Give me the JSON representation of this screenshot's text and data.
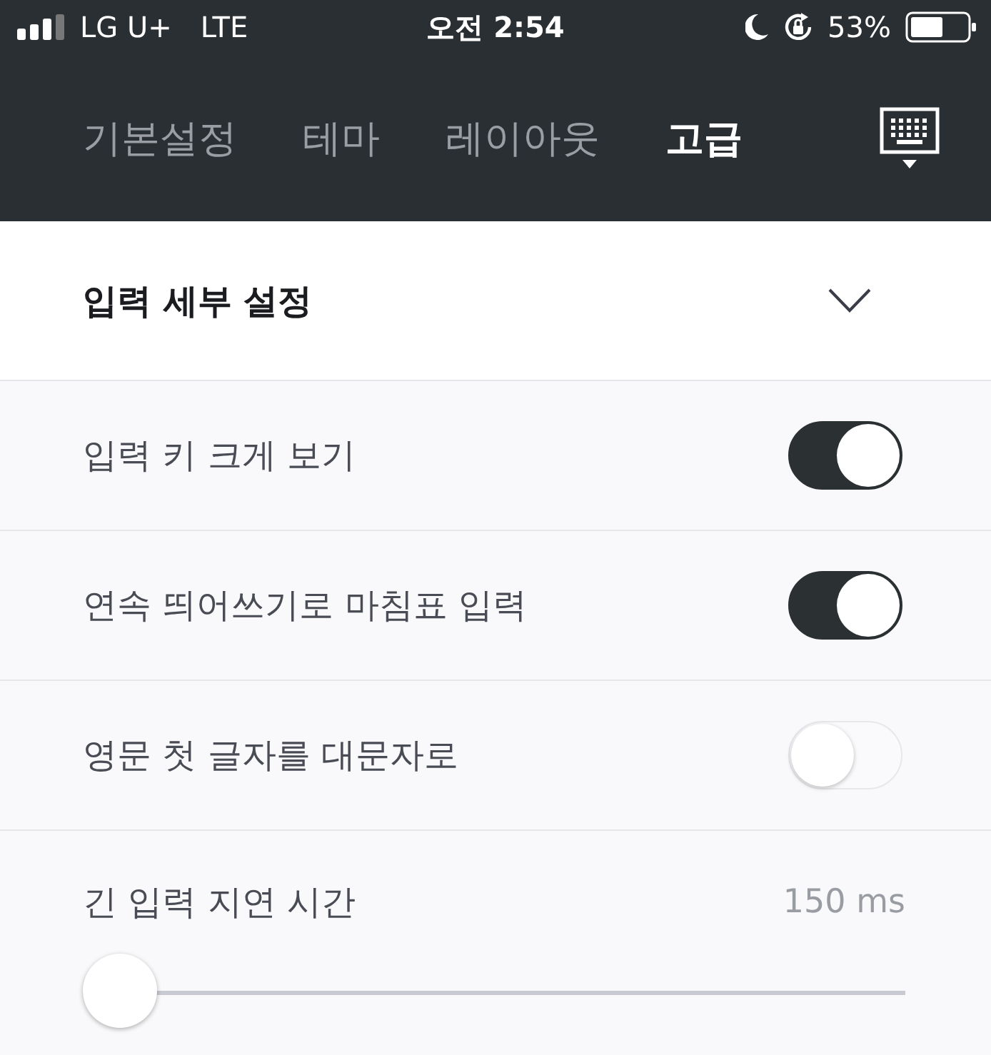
{
  "status_bar": {
    "carrier": "LG U+",
    "network": "LTE",
    "time": "오전 2:54",
    "battery": "53%"
  },
  "tabs": [
    {
      "label": "기본설정",
      "selected": false
    },
    {
      "label": "테마",
      "selected": false
    },
    {
      "label": "레이아웃",
      "selected": false
    },
    {
      "label": "고급",
      "selected": true
    }
  ],
  "section": {
    "title": "입력 세부 설정",
    "expanded": true
  },
  "settings": [
    {
      "kind": "toggle",
      "label": "입력 키 크게 보기",
      "on": true
    },
    {
      "kind": "toggle",
      "label": "연속 띄어쓰기로 마침표 입력",
      "on": true
    },
    {
      "kind": "toggle",
      "label": "영문 첫 글자를 대문자로",
      "on": false
    },
    {
      "kind": "slider",
      "label": "긴 입력 지연 시간",
      "reading": "150 ms",
      "level": 0
    }
  ]
}
